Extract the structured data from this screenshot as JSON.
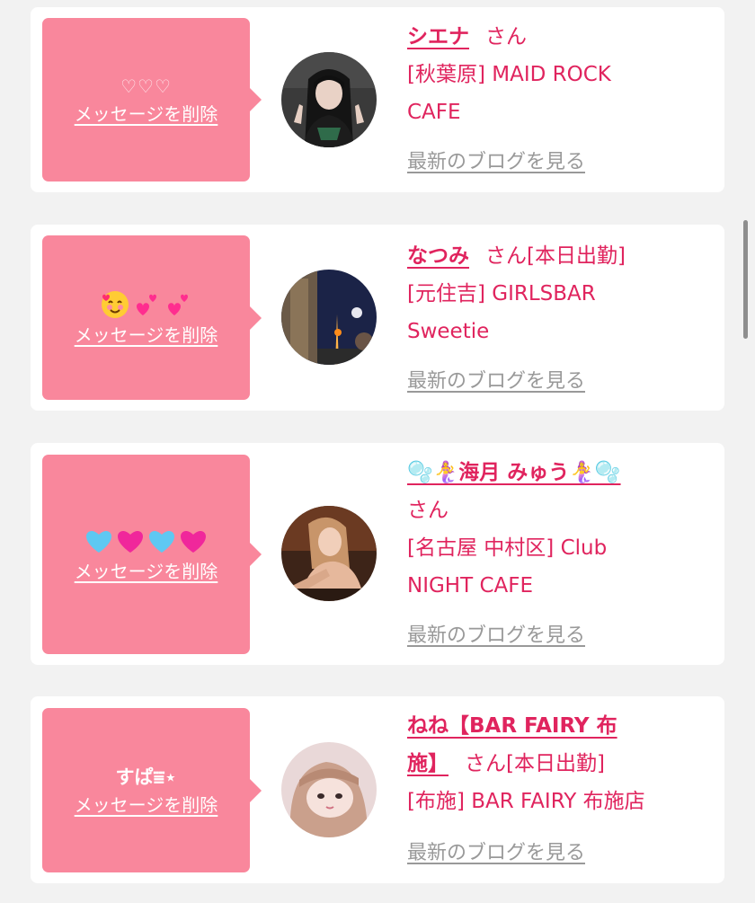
{
  "delete_label": "メッセージを削除",
  "san_label": "さん",
  "blog_label": "最新のブログを見る",
  "cards": [
    {
      "message": "♡♡♡",
      "name": "シエナ",
      "status": "",
      "shop_line1": "[秋葉原] MAID ROCK",
      "shop_line2": "CAFE"
    },
    {
      "message_emoji": [
        "smiling-face-with-hearts",
        "two-hearts",
        "two-hearts"
      ],
      "name": "なつみ",
      "status": "[本日出勤]",
      "shop_line1": "[元住吉] GIRLSBAR",
      "shop_line2": "Sweetie"
    },
    {
      "message_emoji": [
        "light-blue-heart",
        "pink-heart",
        "light-blue-heart",
        "pink-heart"
      ],
      "name": "🫧🧜‍♀️海月 みゅう🧜‍♀️🫧",
      "status": "",
      "shop_line1": "[名古屋 中村区] Club",
      "shop_line2": "NIGHT CAFE"
    },
    {
      "message": "すぱ⩸⋆",
      "name_line1": "ねね【BAR FAIRY 布",
      "name_line2": "施】",
      "status": "[本日出勤]",
      "shop_line1": "[布施] BAR FAIRY 布施店"
    }
  ],
  "colors": {
    "accent": "#e0245e",
    "bubble": "#f9879c",
    "background": "#f2f2f2",
    "link_gray": "#999999"
  }
}
